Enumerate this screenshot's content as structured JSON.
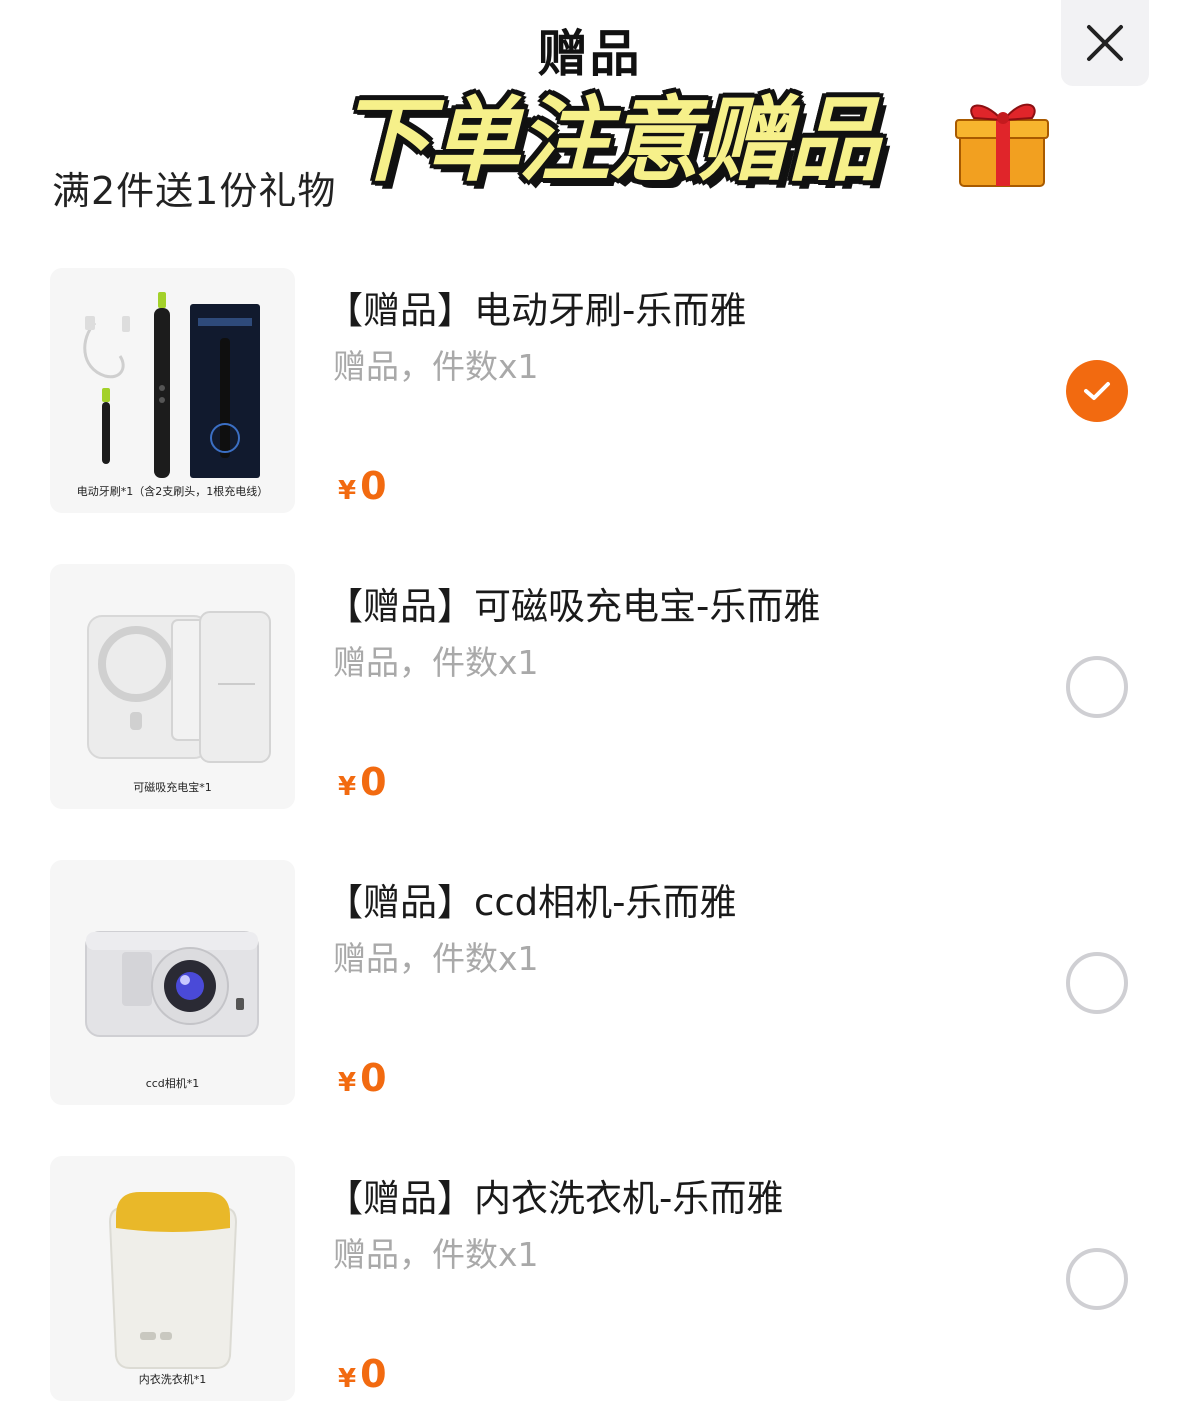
{
  "header": {
    "title": "赠品"
  },
  "banner": {
    "text": "下单注意赠品"
  },
  "subtitle": "满2件送1份礼物",
  "accent_color": "#f26a10",
  "items": [
    {
      "title": "【赠品】电动牙刷-乐而雅",
      "meta": "赠品，件数x1",
      "currency": "¥",
      "price": "0",
      "thumb_caption": "电动牙刷*1（含2支刷头，1根充电线）",
      "selected": true
    },
    {
      "title": "【赠品】可磁吸充电宝-乐而雅",
      "meta": "赠品，件数x1",
      "currency": "¥",
      "price": "0",
      "thumb_caption": "可磁吸充电宝*1",
      "selected": false
    },
    {
      "title": "【赠品】ccd相机-乐而雅",
      "meta": "赠品，件数x1",
      "currency": "¥",
      "price": "0",
      "thumb_caption": "ccd相机*1",
      "selected": false
    },
    {
      "title": "【赠品】内衣洗衣机-乐而雅",
      "meta": "赠品，件数x1",
      "currency": "¥",
      "price": "0",
      "thumb_caption": "内衣洗衣机*1",
      "selected": false
    }
  ]
}
